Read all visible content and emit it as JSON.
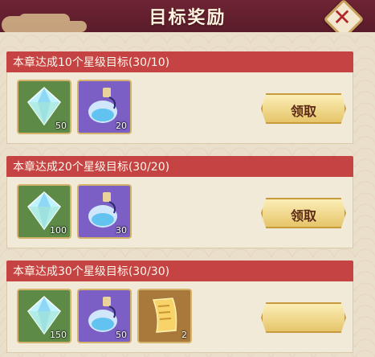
{
  "header": {
    "title": "目标奖励"
  },
  "rewards": [
    {
      "goal": "本章达成10个星级目标(30/10)",
      "items": [
        {
          "icon": "crystal-icon",
          "qty": "50"
        },
        {
          "icon": "potion-icon",
          "qty": "20"
        }
      ],
      "button": "领取"
    },
    {
      "goal": "本章达成20个星级目标(30/20)",
      "items": [
        {
          "icon": "crystal-icon",
          "qty": "100"
        },
        {
          "icon": "potion-icon",
          "qty": "30"
        }
      ],
      "button": "领取"
    },
    {
      "goal": "本章达成30个星级目标(30/30)",
      "items": [
        {
          "icon": "crystal-icon",
          "qty": "150"
        },
        {
          "icon": "potion-icon",
          "qty": "50"
        },
        {
          "icon": "scroll-icon",
          "qty": "2"
        }
      ],
      "button": ""
    }
  ],
  "colors": {
    "accent": "#c54343",
    "panel": "#eadfca",
    "frame": "#5a1e2b"
  }
}
